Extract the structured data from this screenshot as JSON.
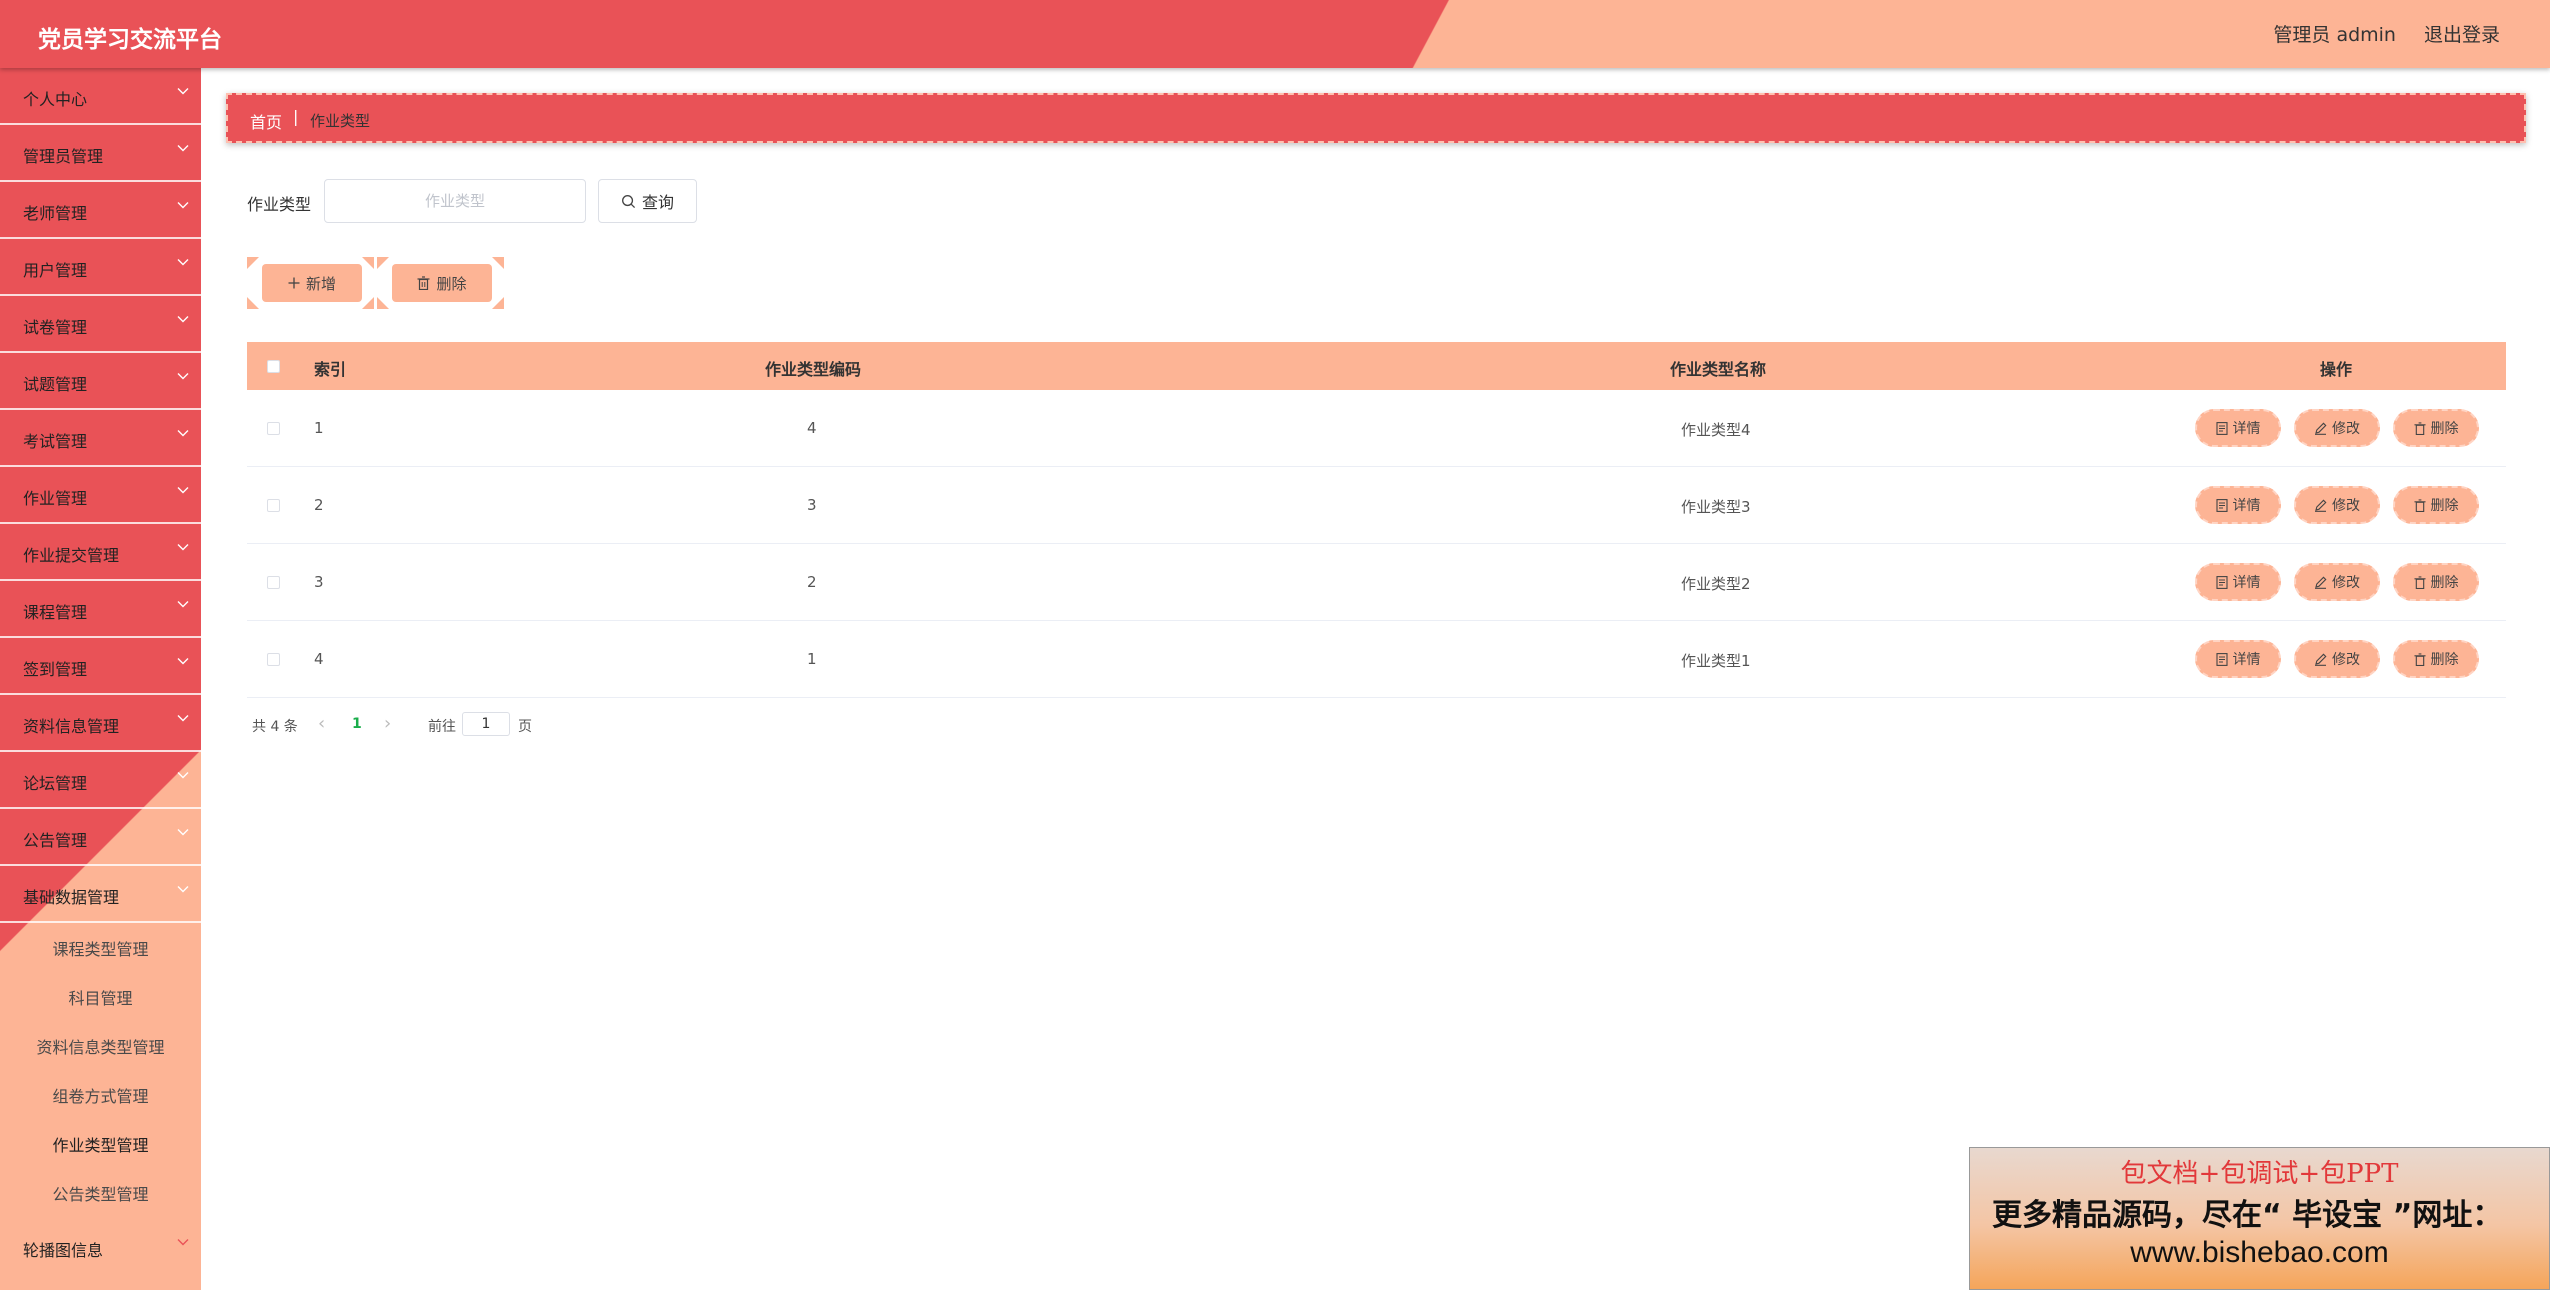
{
  "header": {
    "title": "党员学习交流平台",
    "user_label": "管理员 admin",
    "logout_label": "退出登录"
  },
  "sidebar": {
    "items": [
      {
        "label": "个人中心"
      },
      {
        "label": "管理员管理"
      },
      {
        "label": "老师管理"
      },
      {
        "label": "用户管理"
      },
      {
        "label": "试卷管理"
      },
      {
        "label": "试题管理"
      },
      {
        "label": "考试管理"
      },
      {
        "label": "作业管理"
      },
      {
        "label": "作业提交管理"
      },
      {
        "label": "课程管理"
      },
      {
        "label": "签到管理"
      },
      {
        "label": "资料信息管理"
      },
      {
        "label": "论坛管理"
      },
      {
        "label": "公告管理"
      },
      {
        "label": "基础数据管理"
      }
    ],
    "submenu": [
      {
        "label": "课程类型管理"
      },
      {
        "label": "科目管理"
      },
      {
        "label": "资料信息类型管理"
      },
      {
        "label": "组卷方式管理"
      },
      {
        "label": "作业类型管理"
      },
      {
        "label": "公告类型管理"
      }
    ],
    "last_item": {
      "label": "轮播图信息"
    }
  },
  "breadcrumb": {
    "home": "首页",
    "separator": "|",
    "current": "作业类型"
  },
  "search": {
    "label": "作业类型",
    "placeholder": "作业类型",
    "query_label": "查询"
  },
  "actions": {
    "add_label": "新增",
    "delete_label": "删除"
  },
  "table": {
    "columns": {
      "index": "索引",
      "code": "作业类型编码",
      "name": "作业类型名称",
      "ops": "操作"
    },
    "rows": [
      {
        "index": "1",
        "code": "4",
        "name": "作业类型4"
      },
      {
        "index": "2",
        "code": "3",
        "name": "作业类型3"
      },
      {
        "index": "3",
        "code": "2",
        "name": "作业类型2"
      },
      {
        "index": "4",
        "code": "1",
        "name": "作业类型1"
      }
    ],
    "op_labels": {
      "detail": "详情",
      "edit": "修改",
      "delete": "删除"
    }
  },
  "pagination": {
    "total": "共 4 条",
    "prev": "‹",
    "current": "1",
    "next": "›",
    "goto": "前往",
    "goto_value": "1",
    "page_suffix": "页"
  },
  "ad": {
    "line1": "包文档+包调试+包PPT",
    "line2": "更多精品源码，尽在“ 毕设宝 ”网址：",
    "line3": "www.bishebao.com"
  },
  "colors": {
    "primary_red": "#e95257",
    "accent_peach": "#fdb495",
    "pagination_active": "#1aad4b"
  }
}
